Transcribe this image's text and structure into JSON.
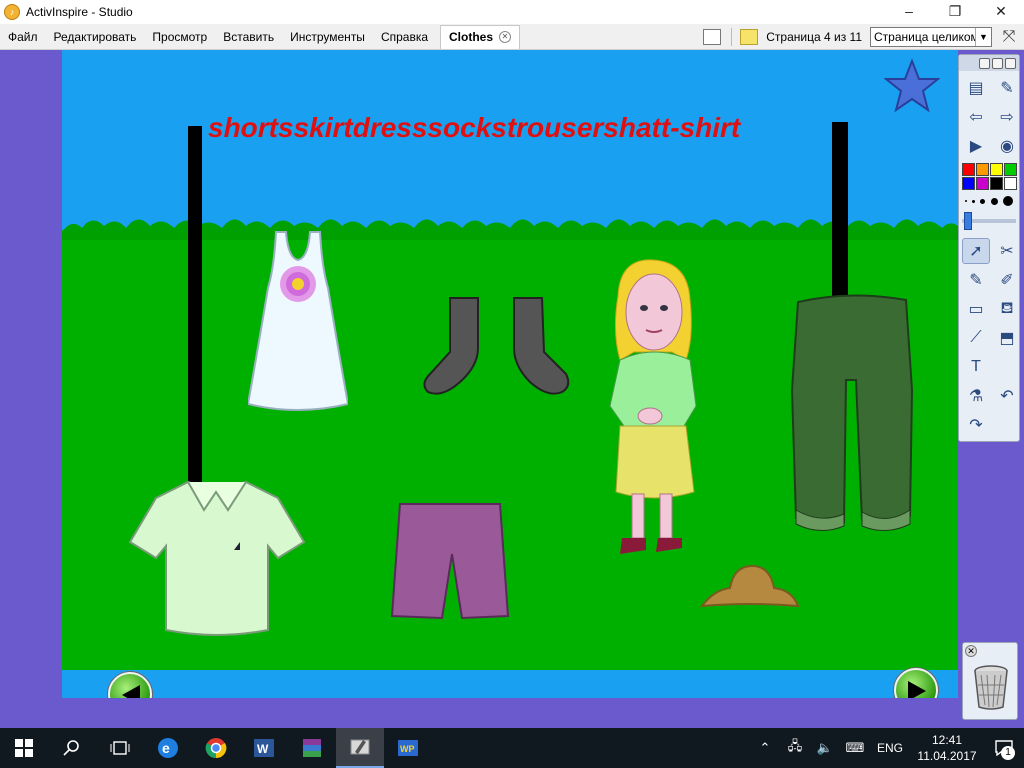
{
  "window": {
    "title": "ActivInspire - Studio",
    "minimize": "–",
    "maximize": "❐",
    "close": "✕"
  },
  "menu": {
    "items": [
      "Файл",
      "Редактировать",
      "Просмотр",
      "Вставить",
      "Инструменты",
      "Справка"
    ],
    "tab_label": "Clothes",
    "page_indicator": "Страница 4 из 11",
    "zoom_value": "Страница целиком"
  },
  "flipchart": {
    "word_bar": "shortsskirtdresssockstrousershatt-shirt"
  },
  "taskbar": {
    "language": "ENG",
    "time": "12:41",
    "date": "11.04.2017",
    "notification_count": "1"
  },
  "colors": {
    "sky": "#1aa0f0",
    "grass": "#00b000",
    "word_bar": "#e01010",
    "sidebar": "#6a5acd"
  },
  "toolbox": {
    "palette": [
      "#ff0000",
      "#ff9900",
      "#ffff00",
      "#00cc00",
      "#0000ff",
      "#cc00cc",
      "#000000",
      "#ffffff"
    ]
  }
}
